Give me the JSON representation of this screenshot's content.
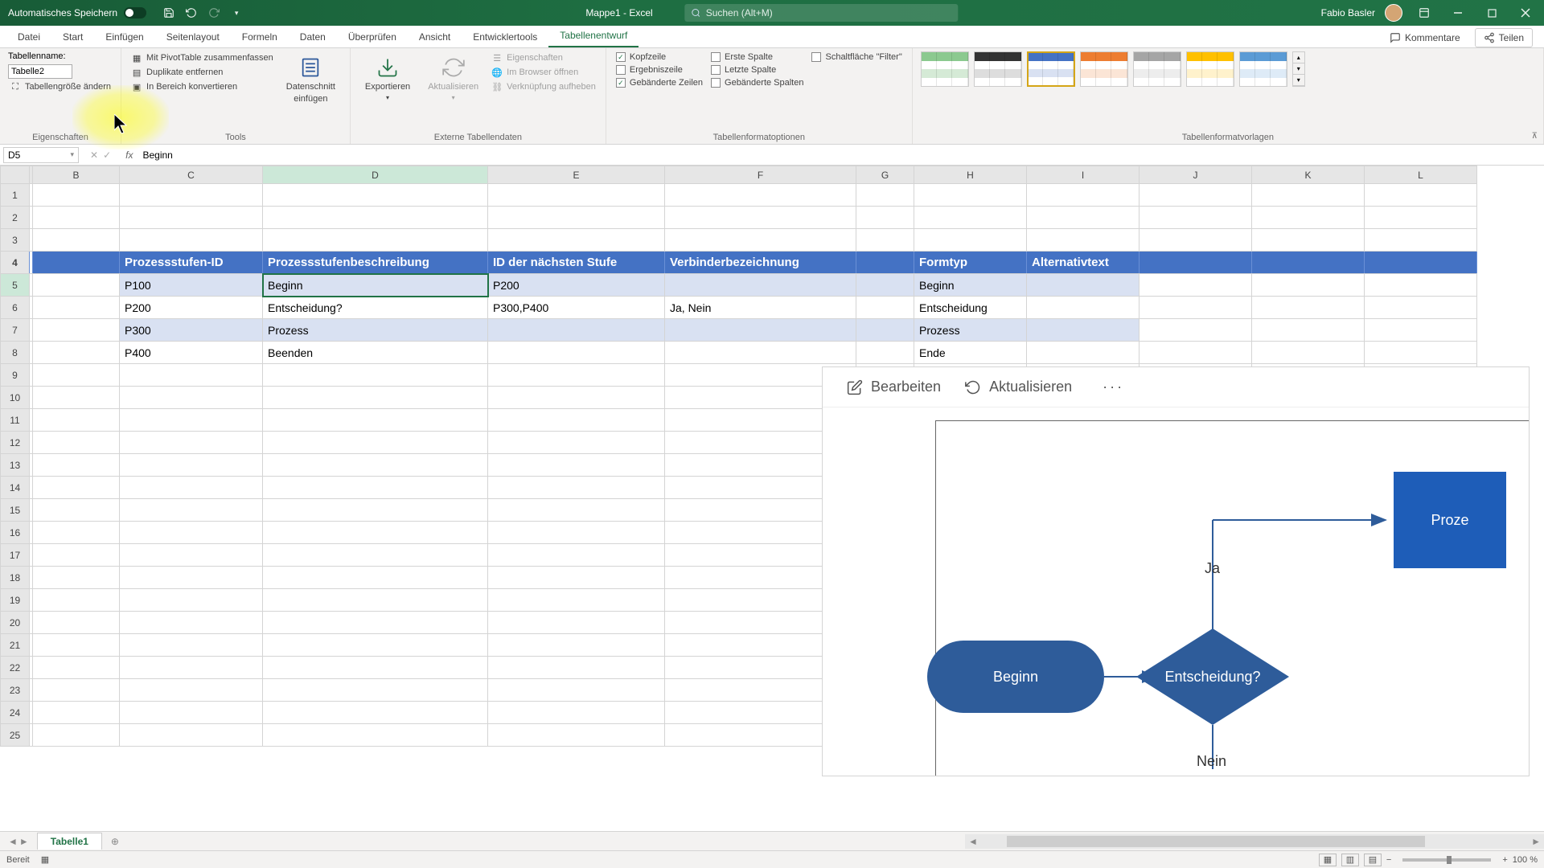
{
  "title_bar": {
    "autosave_label": "Automatisches Speichern",
    "doc_title": "Mappe1 - Excel",
    "search_placeholder": "Suchen (Alt+M)",
    "user_name": "Fabio Basler"
  },
  "ribbon_tabs": [
    "Datei",
    "Start",
    "Einfügen",
    "Seitenlayout",
    "Formeln",
    "Daten",
    "Überprüfen",
    "Ansicht",
    "Entwicklertools",
    "Tabellenentwurf"
  ],
  "ribbon_right": {
    "comments": "Kommentare",
    "share": "Teilen"
  },
  "ribbon": {
    "props": {
      "label": "Tabellenname:",
      "table_name": "Tabelle2",
      "resize": "Tabellengröße ändern",
      "group": "Eigenschaften"
    },
    "tools": {
      "pivot": "Mit PivotTable zusammenfassen",
      "dedupe": "Duplikate entfernen",
      "convert": "In Bereich konvertieren",
      "slicer1": "Datenschnitt",
      "slicer2": "einfügen",
      "group": "Tools"
    },
    "external": {
      "export": "Exportieren",
      "refresh": "Aktualisieren",
      "props": "Eigenschaften",
      "browser": "Im Browser öffnen",
      "unlink": "Verknüpfung aufheben",
      "group": "Externe Tabellendaten"
    },
    "style_opts": {
      "header": "Kopfzeile",
      "total": "Ergebniszeile",
      "banded_rows": "Gebänderte Zeilen",
      "first_col": "Erste Spalte",
      "last_col": "Letzte Spalte",
      "banded_cols": "Gebänderte Spalten",
      "filter": "Schaltfläche \"Filter\"",
      "group": "Tabellenformatoptionen"
    },
    "styles_group": "Tabellenformatvorlagen"
  },
  "formula_bar": {
    "cell_ref": "D5",
    "value": "Beginn"
  },
  "columns": [
    "B",
    "C",
    "D",
    "E",
    "F",
    "G",
    "H",
    "I",
    "J",
    "K",
    "L"
  ],
  "table": {
    "headers": [
      "Prozessstufen-ID",
      "Prozessstufenbeschreibung",
      "ID der nächsten Stufe",
      "Verbinderbezeichnung",
      "Formtyp",
      "Alternativtext"
    ],
    "rows": [
      {
        "c": "P100",
        "d": "Beginn",
        "e": "P200",
        "f": "",
        "h": "Beginn"
      },
      {
        "c": "P200",
        "d": "Entscheidung?",
        "e": "P300,P400",
        "f": "Ja, Nein",
        "h": "Entscheidung"
      },
      {
        "c": "P300",
        "d": "Prozess",
        "e": "",
        "f": "",
        "h": "Prozess"
      },
      {
        "c": "P400",
        "d": "Beenden",
        "e": "",
        "f": "",
        "h": "Ende"
      }
    ]
  },
  "chart": {
    "edit": "Bearbeiten",
    "refresh": "Aktualisieren",
    "nodes": {
      "start": "Beginn",
      "decision": "Entscheidung?",
      "process": "Proze"
    },
    "labels": {
      "yes": "Ja",
      "no": "Nein"
    }
  },
  "sheet_tab": "Tabelle1",
  "status": {
    "ready": "Bereit",
    "zoom": "100 %"
  }
}
